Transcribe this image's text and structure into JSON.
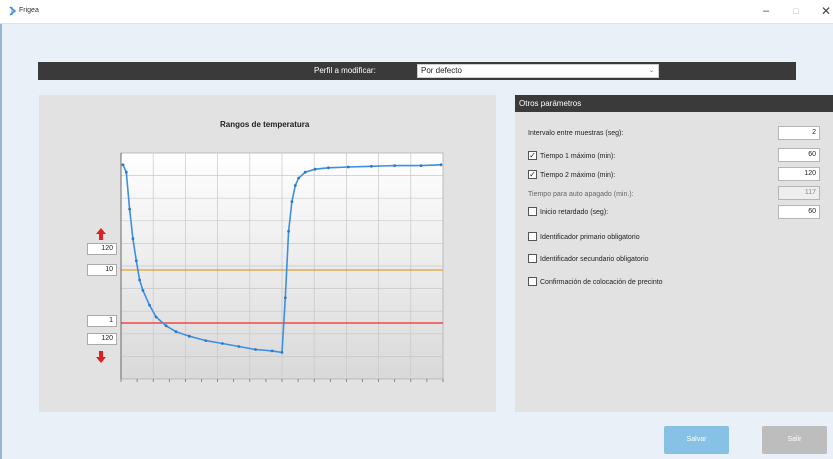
{
  "window": {
    "title": "Frigea",
    "minimize": "–",
    "maximize": "□",
    "close": "✕"
  },
  "profile": {
    "label": "Perfil a modificar:",
    "value": "Por defecto"
  },
  "chart": {
    "title": "Rangos de temperatura",
    "upper_top_value": "120",
    "upper_bottom_value": "10",
    "lower_top_value": "1",
    "lower_bottom_value": "120",
    "colors": {
      "upper_line": "#e0a030",
      "lower_line": "#f02c2c",
      "series": "#3d8fe0",
      "arrows": "#e02020"
    }
  },
  "chart_data": {
    "type": "line",
    "title": "Rangos de temperatura",
    "xlabel": "",
    "ylabel": "",
    "grid": true,
    "x": [
      0,
      1,
      2,
      3,
      4,
      5,
      6,
      8,
      10,
      13,
      16,
      20,
      25,
      30,
      35,
      40,
      45,
      48,
      49,
      50,
      51,
      52,
      53,
      55,
      58,
      62,
      68,
      75,
      82,
      90,
      96
    ],
    "series": [
      {
        "values": [
          10,
          9.5,
          7,
          5,
          3.5,
          2.2,
          1.5,
          0.5,
          -0.3,
          -0.9,
          -1.3,
          -1.6,
          -1.9,
          -2.1,
          -2.3,
          -2.5,
          -2.6,
          -2.7,
          1,
          5.5,
          7.5,
          8.6,
          9.1,
          9.5,
          9.7,
          9.8,
          9.85,
          9.9,
          9.95,
          9.95,
          10
        ]
      }
    ],
    "threshold_lines": [
      "10",
      "1"
    ]
  },
  "params": {
    "header": "Otros parámetros",
    "rows": [
      {
        "label": "Intervalo entre muestras (seg):",
        "value": "2",
        "checkbox": false,
        "checked": false,
        "disabled": false
      },
      {
        "label": "Tiempo 1 máximo (min):",
        "value": "60",
        "checkbox": true,
        "checked": true,
        "disabled": false
      },
      {
        "label": "Tiempo 2 máximo (min):",
        "value": "120",
        "checkbox": true,
        "checked": true,
        "disabled": false
      },
      {
        "label": "Tiempo para auto apagado (min.):",
        "value": "117",
        "checkbox": false,
        "checked": false,
        "disabled": true
      },
      {
        "label": "Inicio retardado (seg):",
        "value": "60",
        "checkbox": true,
        "checked": false,
        "disabled": false
      },
      {
        "label": "Identificador primario obligatorio",
        "value": null,
        "checkbox": true,
        "checked": false,
        "disabled": false
      },
      {
        "label": "Identificador secundario obligatorio",
        "value": null,
        "checkbox": true,
        "checked": false,
        "disabled": false
      },
      {
        "label": "Confirmación de colocación de precinto",
        "value": null,
        "checkbox": true,
        "checked": false,
        "disabled": false
      }
    ]
  },
  "buttons": {
    "save": "Salvar",
    "exit": "Salir"
  }
}
